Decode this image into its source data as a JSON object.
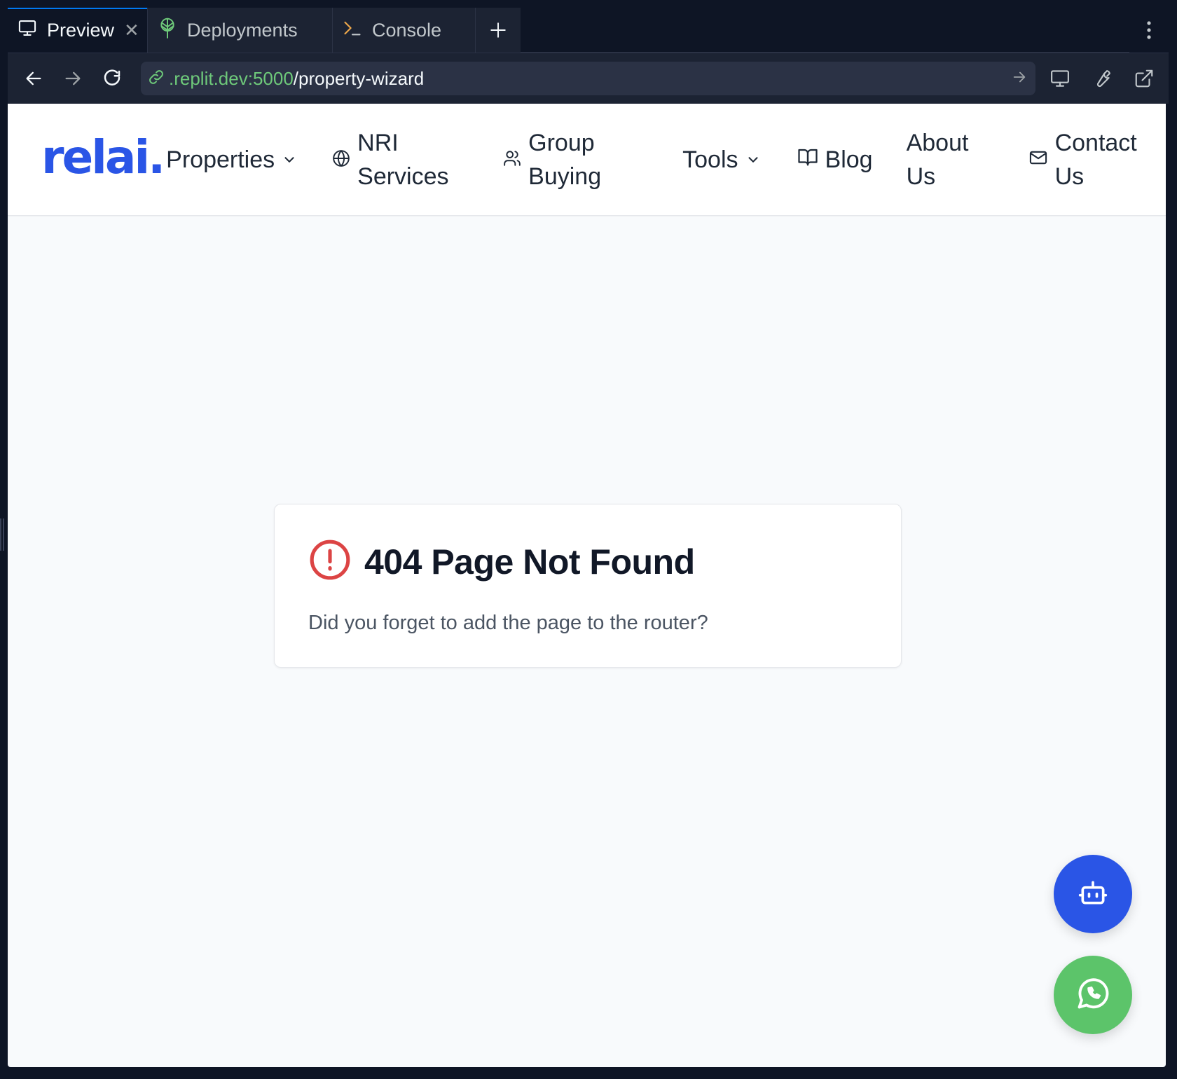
{
  "tabs": [
    {
      "label": "Preview",
      "icon": "monitor-icon",
      "active": true,
      "closable": true
    },
    {
      "label": "Deployments",
      "icon": "deployments-icon",
      "active": false
    },
    {
      "label": "Console",
      "icon": "terminal-icon",
      "active": false
    }
  ],
  "urlbar": {
    "host": ".replit.dev:5000",
    "path": "/property-wizard"
  },
  "site": {
    "logo": "relai.",
    "nav": {
      "properties": "Properties",
      "nri_line1": "NRI",
      "nri_line2": "Services",
      "group_line1": "Group",
      "group_line2": "Buying",
      "tools": "Tools",
      "blog": "Blog",
      "about_line1": "About",
      "about_line2": "Us",
      "contact_line1": "Contact",
      "contact_line2": "Us"
    }
  },
  "error_card": {
    "title": "404 Page Not Found",
    "message": "Did you forget to add the page to the router?"
  },
  "colors": {
    "brand_blue": "#2a55e6",
    "error_red": "#dc4444",
    "whatsapp_green": "#5cc46a",
    "url_host_green": "#6ec97a"
  }
}
